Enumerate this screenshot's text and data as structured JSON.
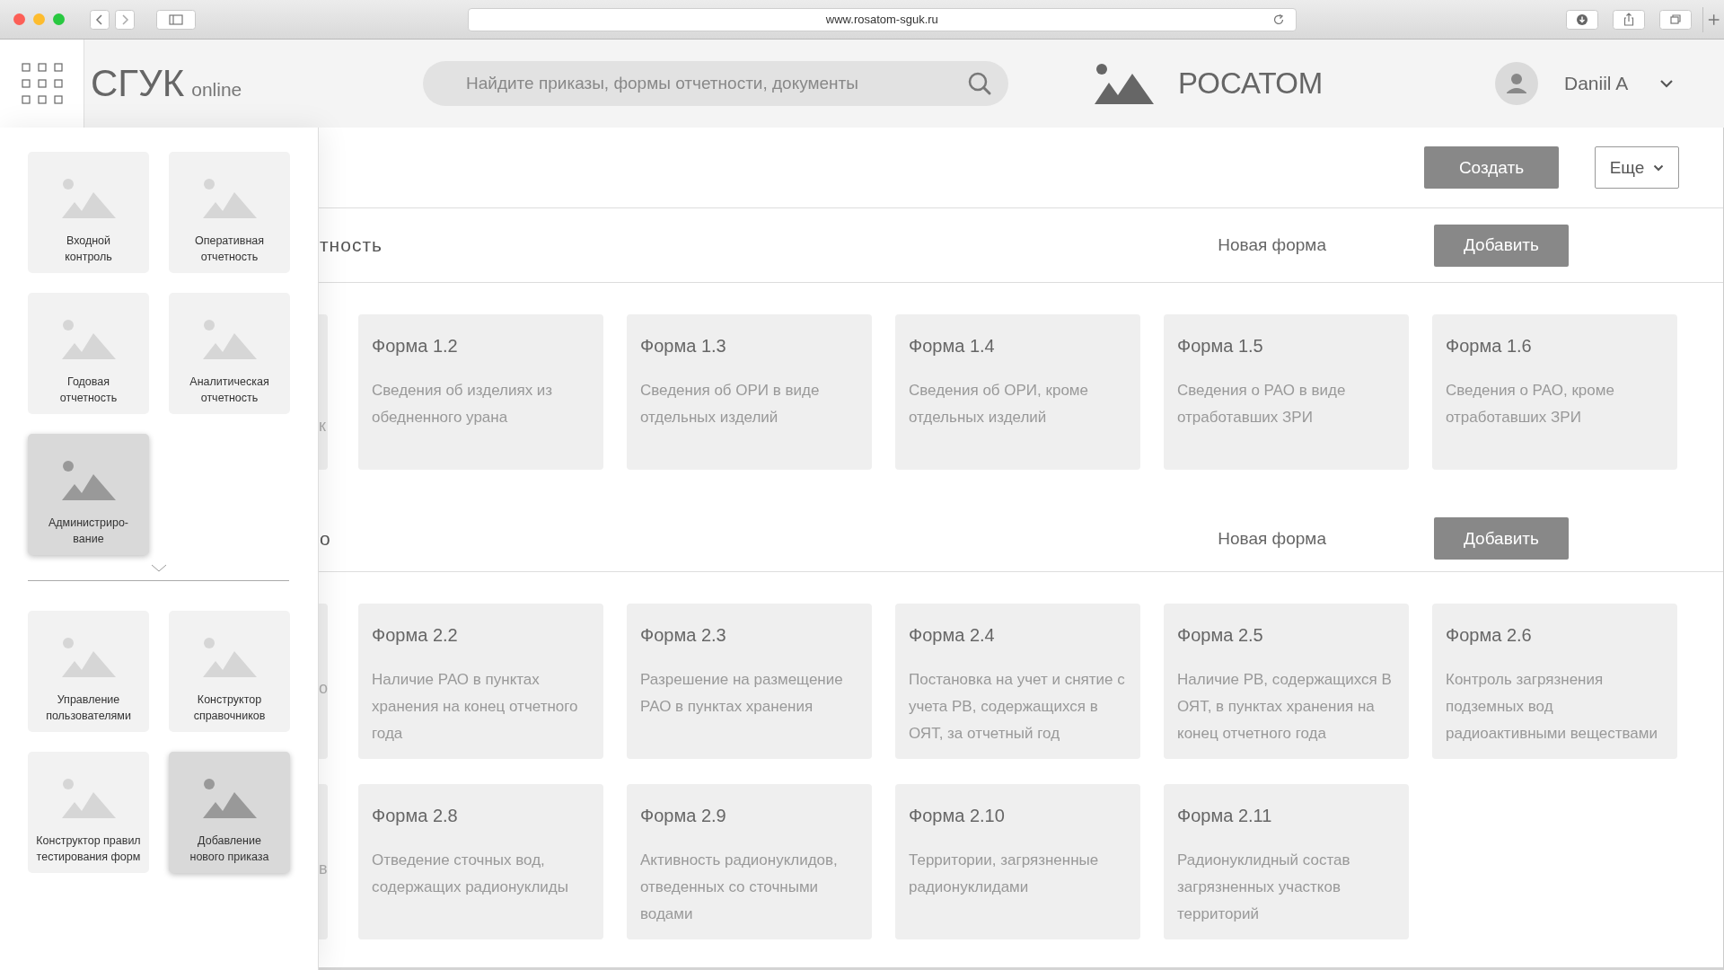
{
  "browser": {
    "url": "www.rosatom-sguk.ru"
  },
  "header": {
    "brand": "СГУК",
    "brand_suffix": "online",
    "search": {
      "placeholder": "Найдите приказы, формы отчетности, документы"
    },
    "company": "РОСАТОМ",
    "user": "Daniil A"
  },
  "launcher": {
    "groups": [
      {
        "tiles": [
          {
            "label": "Входной\nконтроль",
            "selected": false
          },
          {
            "label": "Оперативная\nотчетность",
            "selected": false
          },
          {
            "label": "Годовая\nотчетность",
            "selected": false
          },
          {
            "label": "Аналитическая\nотчетность",
            "selected": false
          },
          {
            "label": "Администриро-\nвание",
            "selected": true
          }
        ]
      },
      {
        "tiles": [
          {
            "label": "Управление\nпользователями",
            "selected": false
          },
          {
            "label": "Конструктор\nсправочников",
            "selected": false
          },
          {
            "label": "Конструктор правил\nтестирования форм",
            "selected": false
          },
          {
            "label": "Добавление\nнового приказа",
            "selected": true
          }
        ]
      }
    ]
  },
  "toolbar": {
    "buttons": [
      {
        "label": "Создать",
        "kind": "primary"
      },
      {
        "label": "Еще",
        "kind": "dropdown"
      }
    ]
  },
  "sections": [
    {
      "title_fragment": "тность",
      "new_form_label": "Новая форма",
      "add_button": "Добавить",
      "rows": [
        {
          "partial": {
            "line_2": "к"
          },
          "cards": [
            {
              "title": "Форма 1.2",
              "description": "Сведения об изделиях из обедненного урана"
            },
            {
              "title": "Форма 1.3",
              "description": "Сведения об ОРИ в виде отдельных изделий"
            },
            {
              "title": "Форма 1.4",
              "description": "Сведения об ОРИ, кроме отдельных изделий"
            },
            {
              "title": "Форма 1.5",
              "description": "Сведения о РАО в виде отработавших ЗРИ"
            },
            {
              "title": "Форма 1.6",
              "description": "Сведения о РАО, кроме отработавших ЗРИ"
            }
          ]
        }
      ]
    },
    {
      "title_fragment": "о",
      "new_form_label": "Новая форма",
      "add_button": "Добавить",
      "rows": [
        {
          "partial": {
            "line_1": "о"
          },
          "cards": [
            {
              "title": "Форма 2.2",
              "description": "Наличие РАО в пунктах хранения на конец отчетного года"
            },
            {
              "title": "Форма 2.3",
              "description": "Разрешение на размещение РАО в пунктах хранения"
            },
            {
              "title": "Форма 2.4",
              "description": "Постановка на учет и снятие с учета РВ, содержащихся в ОЯТ, за отчетный год"
            },
            {
              "title": "Форма 2.5",
              "description": "Наличие РВ, содержащихся В ОЯТ, в пунктах хранения на конец отчетного года"
            },
            {
              "title": "Форма 2.6",
              "description": "Контроль загрязнения подземных вод радиоактивными веществами"
            }
          ]
        },
        {
          "partial": {
            "line_1": "в"
          },
          "cards": [
            {
              "title": "Форма 2.8",
              "description": "Отведение сточных вод, содержащих радионуклиды"
            },
            {
              "title": "Форма 2.9",
              "description": "Активность радионуклидов, отведенных со сточными водами"
            },
            {
              "title": "Форма 2.10",
              "description": "Территории, загрязненные радионуклидами"
            },
            {
              "title": "Форма 2.11",
              "description": "Радионуклидный состав загрязненных участков территорий"
            }
          ]
        }
      ]
    }
  ]
}
